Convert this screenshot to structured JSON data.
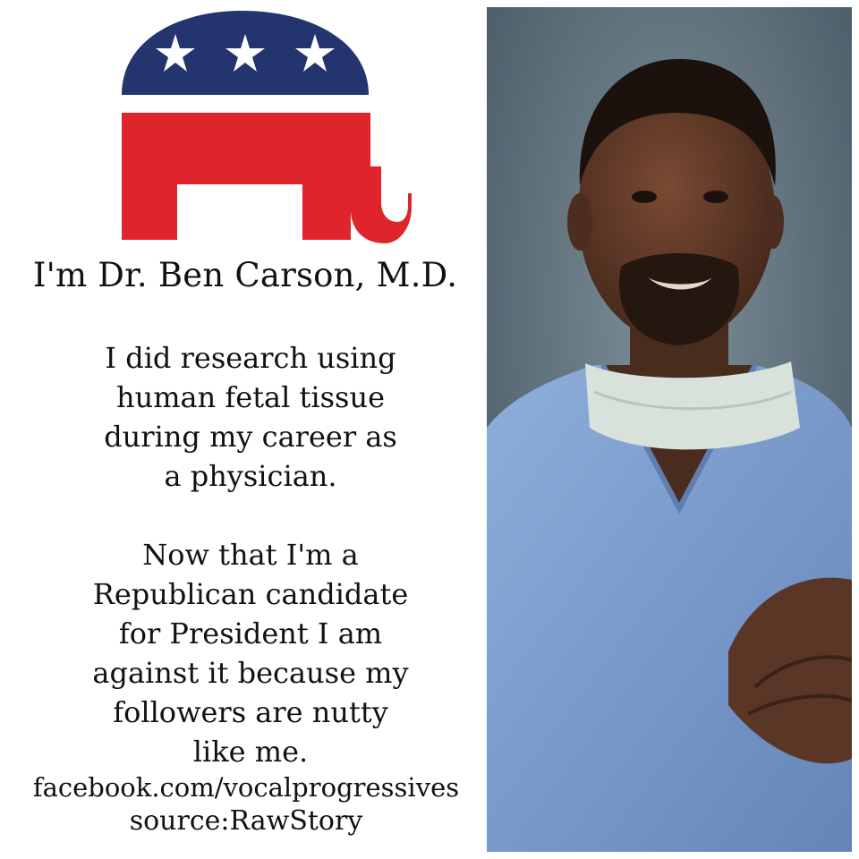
{
  "logo": {
    "icon": "republican-elephant-icon",
    "colors": {
      "blue": "#24346e",
      "red": "#e0242b",
      "star": "#ffffff"
    }
  },
  "headline": "I'm Dr. Ben Carson, M.D.",
  "paragraphs": [
    "I did research using\nhuman fetal tissue\nduring my career as\na physician.",
    "Now that I'm a\nRepublican candidate\nfor President I am\nagainst it because my\nfollowers are nutty\nlike me."
  ],
  "footer": {
    "url": "facebook.com/vocalprogressives",
    "source": "source:RawStory"
  },
  "photo": {
    "subject": "portrait-photo",
    "colors": {
      "background": "#5b6f7a",
      "scrubs": "#7c9ccc",
      "mask": "#d9e2da",
      "skin": "#5a3626"
    }
  }
}
